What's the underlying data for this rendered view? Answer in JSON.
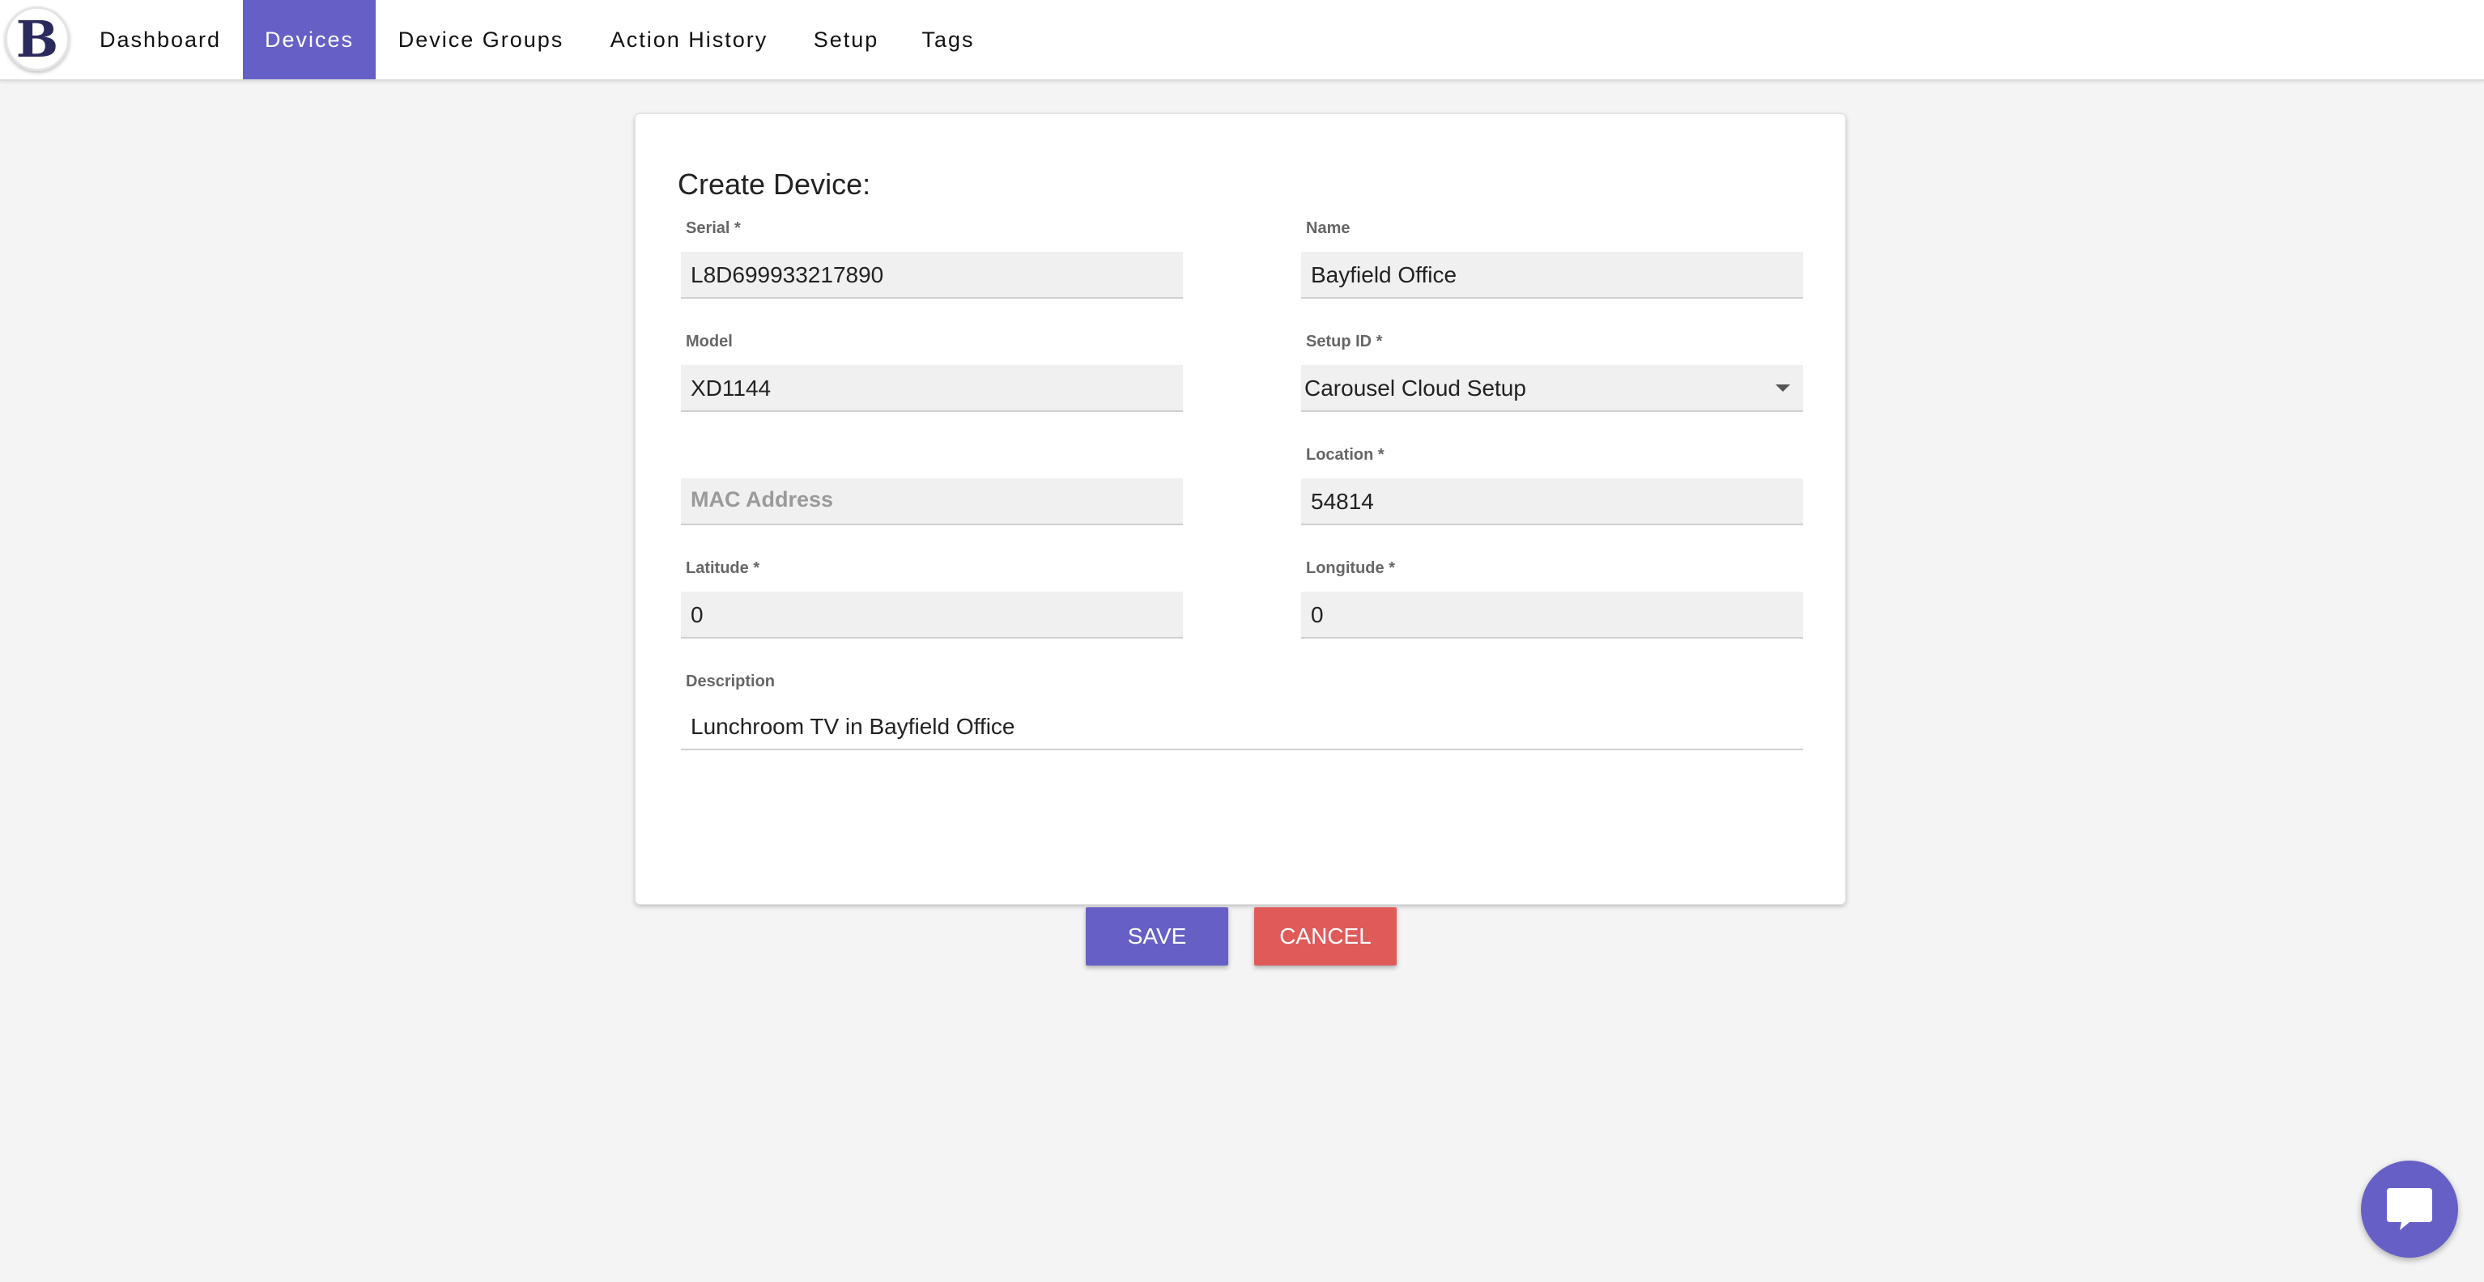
{
  "nav": {
    "logo_letter": "B",
    "items": [
      {
        "label": "Dashboard",
        "active": false
      },
      {
        "label": "Devices",
        "active": true
      },
      {
        "label": "Device Groups",
        "active": false
      },
      {
        "label": "Action History",
        "active": false
      },
      {
        "label": "Setup",
        "active": false
      },
      {
        "label": "Tags",
        "active": false
      }
    ]
  },
  "form": {
    "title": "Create Device:",
    "serial": {
      "label": "Serial *",
      "value": "L8D699933217890"
    },
    "name": {
      "label": "Name",
      "value": "Bayfield Office"
    },
    "model": {
      "label": "Model",
      "value": "XD1144"
    },
    "setup_id": {
      "label": "Setup ID *",
      "value": "Carousel Cloud Setup"
    },
    "mac_address": {
      "label": "",
      "placeholder": "MAC Address",
      "value": ""
    },
    "location": {
      "label": "Location *",
      "value": "54814"
    },
    "latitude": {
      "label": "Latitude *",
      "value": "0"
    },
    "longitude": {
      "label": "Longitude *",
      "value": "0"
    },
    "description": {
      "label": "Description",
      "value": "Lunchroom TV in Bayfield Office"
    },
    "save_label": "SAVE",
    "cancel_label": "CANCEL"
  },
  "colors": {
    "accent": "#6660c6",
    "danger": "#e05a5a",
    "background": "#f4f4f4"
  },
  "icons": {
    "logo": "brand-logo-b",
    "dropdown": "chevron-down-icon",
    "chat": "chat-bubble-icon"
  }
}
